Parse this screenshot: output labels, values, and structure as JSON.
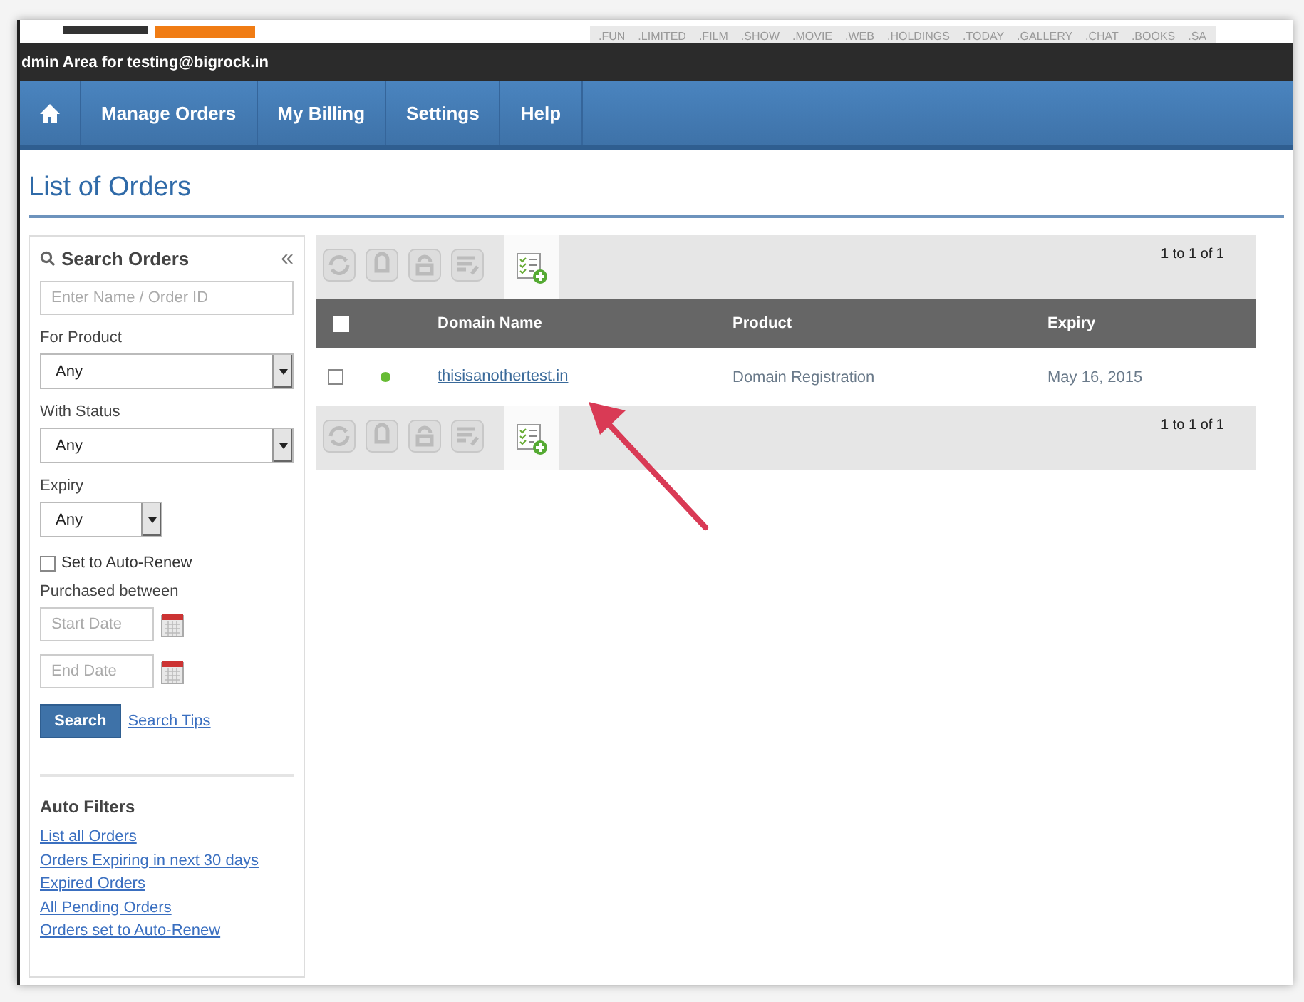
{
  "tld_strip": [
    ".FUN",
    ".LIMITED",
    ".FILM",
    ".SHOW",
    ".MOVIE",
    ".WEB",
    ".HOLDINGS",
    ".TODAY",
    ".GALLERY",
    ".CHAT",
    ".BOOKS",
    ".SA"
  ],
  "admin_bar": {
    "text": "dmin Area for testing@bigrock.in"
  },
  "nav": [
    {
      "kind": "home",
      "selected": false
    },
    {
      "kind": "text",
      "label": "Manage Orders",
      "selected": false
    },
    {
      "kind": "text",
      "label": "My Billing",
      "selected": false
    },
    {
      "kind": "text",
      "label": "Settings",
      "selected": false
    },
    {
      "kind": "text",
      "label": "Help",
      "selected": false
    }
  ],
  "page_title": "List of Orders",
  "sidebar": {
    "title": "Search Orders",
    "collapse": "«",
    "search": {
      "placeholder": "Enter Name / Order ID"
    },
    "filters": [
      {
        "label": "For Product",
        "value": "Any",
        "wide": true
      },
      {
        "label": "With Status",
        "value": "Any",
        "wide": true
      },
      {
        "label": "Expiry",
        "value": "Any",
        "wide": false
      }
    ],
    "auto_renew": {
      "label": "Set to Auto-Renew",
      "checked": false
    },
    "purchased_label": "Purchased between",
    "start_date": {
      "placeholder": "Start Date"
    },
    "end_date": {
      "placeholder": "End Date"
    },
    "search_button": "Search",
    "search_tips": "Search Tips",
    "auto_filters_title": "Auto Filters",
    "auto_filters": [
      "List all Orders",
      "Orders Expiring in next 30 days",
      "Expired Orders",
      "All Pending Orders",
      "Orders set to Auto-Renew"
    ]
  },
  "table": {
    "pagination_top": "1 to 1 of 1",
    "pagination_bottom": "1 to 1 of 1",
    "header_checked": false,
    "columns": [
      "Domain Name",
      "Product",
      "Expiry"
    ],
    "rows": [
      {
        "checked": false,
        "color": "#66bb33",
        "domain": "thisisanothertest.in",
        "product": "Domain Registration",
        "expiry": "May 16, 2015"
      }
    ]
  }
}
